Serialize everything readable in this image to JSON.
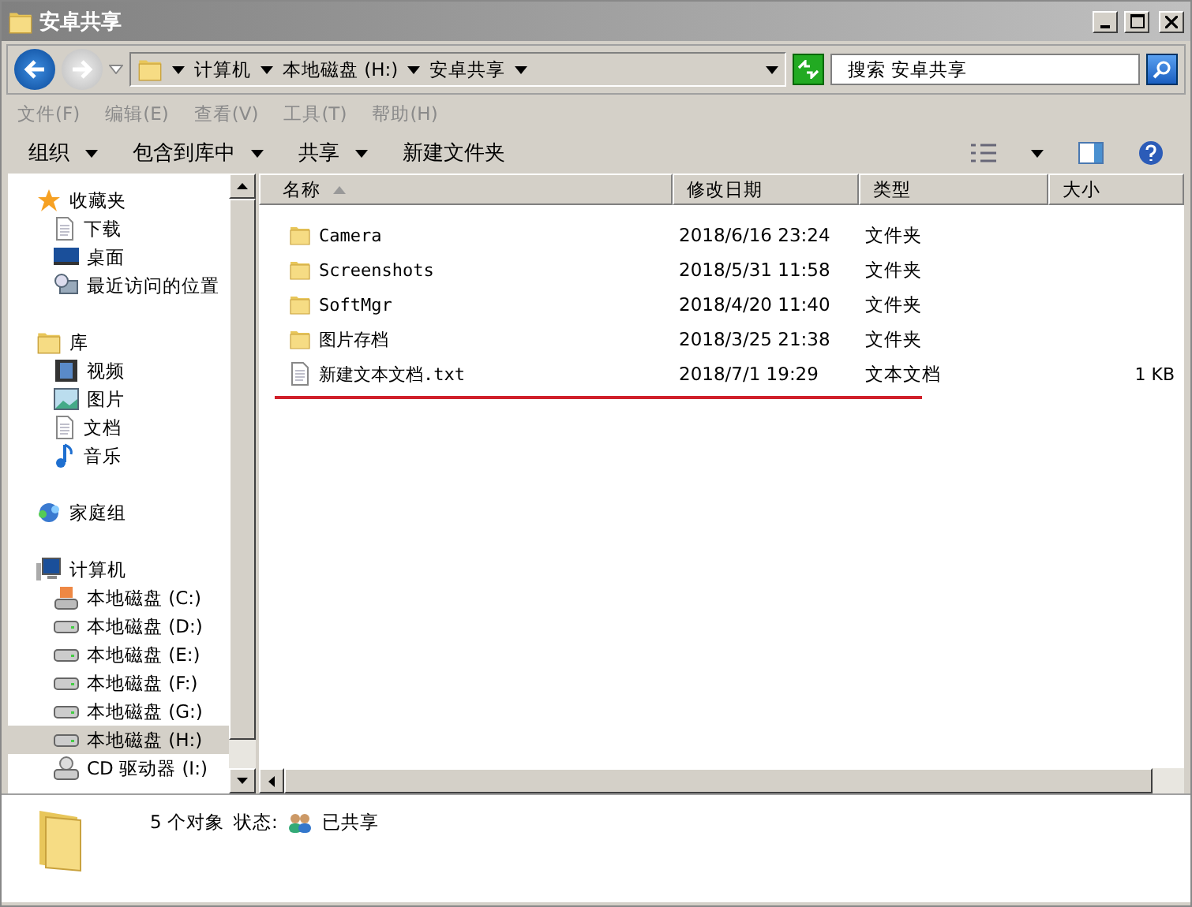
{
  "window": {
    "title": "安卓共享"
  },
  "address": {
    "crumbs": [
      "计算机",
      "本地磁盘 (H:)",
      "安卓共享"
    ]
  },
  "search": {
    "placeholder": "搜索 安卓共享"
  },
  "menu": [
    {
      "label": "文件(F)",
      "disabled": true
    },
    {
      "label": "编辑(E)",
      "disabled": true
    },
    {
      "label": "查看(V)",
      "disabled": true
    },
    {
      "label": "工具(T)",
      "disabled": true
    },
    {
      "label": "帮助(H)",
      "disabled": true
    }
  ],
  "commands": [
    {
      "label": "组织",
      "dropdown": true
    },
    {
      "label": "包含到库中",
      "dropdown": true
    },
    {
      "label": "共享",
      "dropdown": true
    },
    {
      "label": "新建文件夹",
      "dropdown": false
    }
  ],
  "sidebar": {
    "groups": [
      {
        "label": "收藏夹",
        "kind": "star",
        "children": [
          {
            "label": "下载",
            "kind": "page",
            "selected": false
          },
          {
            "label": "桌面",
            "kind": "desktop",
            "selected": false
          },
          {
            "label": "最近访问的位置",
            "kind": "recent",
            "selected": false
          }
        ]
      },
      {
        "label": "库",
        "kind": "library",
        "children": [
          {
            "label": "视频",
            "kind": "video",
            "selected": false
          },
          {
            "label": "图片",
            "kind": "image",
            "selected": false
          },
          {
            "label": "文档",
            "kind": "page",
            "selected": false
          },
          {
            "label": "音乐",
            "kind": "music",
            "selected": false
          }
        ]
      },
      {
        "label": "家庭组",
        "kind": "homegroup"
      },
      {
        "label": "计算机",
        "kind": "computer",
        "children": [
          {
            "label": "本地磁盘 (C:)",
            "kind": "sysdrive",
            "selected": false
          },
          {
            "label": "本地磁盘 (D:)",
            "kind": "drive",
            "selected": false
          },
          {
            "label": "本地磁盘 (E:)",
            "kind": "drive",
            "selected": false
          },
          {
            "label": "本地磁盘 (F:)",
            "kind": "drive",
            "selected": false
          },
          {
            "label": "本地磁盘 (G:)",
            "kind": "drive",
            "selected": false
          },
          {
            "label": "本地磁盘 (H:)",
            "kind": "drive",
            "selected": true
          },
          {
            "label": "CD 驱动器 (I:)",
            "kind": "cd",
            "selected": false
          }
        ]
      }
    ]
  },
  "table": {
    "columns": [
      {
        "label": "名称",
        "sorted": true
      },
      {
        "label": "修改日期",
        "sorted": false
      },
      {
        "label": "类型",
        "sorted": false
      },
      {
        "label": "大小",
        "sorted": false
      }
    ],
    "rows": [
      {
        "kind": "folder",
        "name": "Camera",
        "date": "2018/6/16 23:24",
        "type": "文件夹",
        "underlined": false
      },
      {
        "kind": "folder",
        "name": "Screenshots",
        "date": "2018/5/31 11:58",
        "type": "文件夹",
        "underlined": false
      },
      {
        "kind": "folder",
        "name": "SoftMgr",
        "date": "2018/4/20 11:40",
        "type": "文件夹",
        "underlined": false
      },
      {
        "kind": "folder",
        "name": "图片存档",
        "date": "2018/3/25 21:38",
        "type": "文件夹",
        "underlined": false
      },
      {
        "kind": "text",
        "name": "新建文本文档.txt",
        "date": "2018/7/1 19:29",
        "type": "文本文档",
        "size": "1 KB",
        "underlined": true
      }
    ]
  },
  "status_bar": {
    "count": "5 个对象",
    "state_label": "状态:",
    "state": "已共享"
  }
}
